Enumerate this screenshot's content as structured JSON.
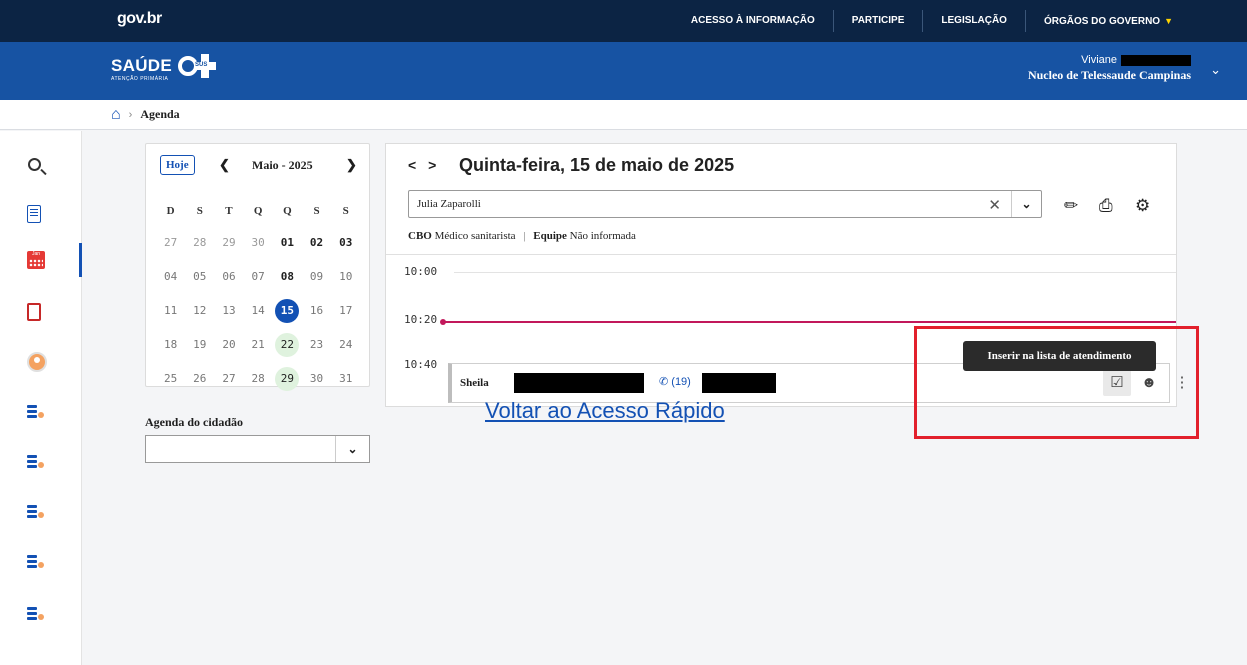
{
  "govbar": {
    "logo": "gov.br",
    "links": [
      "ACESSO À INFORMAÇÃO",
      "PARTICIPE",
      "LEGISLAÇÃO",
      "ÓRGÃOS DO GOVERNO"
    ]
  },
  "header": {
    "brand": "SAÚDE",
    "brand_sub": "ATENÇÃO PRIMÁRIA",
    "esus": "SUS",
    "user_name": "Viviane",
    "unit": "Nucleo de Telessaude Campinas"
  },
  "breadcrumb": {
    "current": "Agenda"
  },
  "sidebar": {
    "items": [
      "search-icon",
      "search-list-icon",
      "calendar-icon",
      "cds-icon",
      "avatar-icon",
      "patient-list-icon",
      "checklist-icon",
      "medical-list-icon",
      "queue-icon",
      "video-list-icon"
    ]
  },
  "mini_calendar": {
    "today_button": "Hoje",
    "month": "Maio - 2025",
    "weekdays": [
      "D",
      "S",
      "T",
      "Q",
      "Q",
      "S",
      "S"
    ],
    "weeks": [
      [
        "27",
        "28",
        "29",
        "30",
        "01",
        "02",
        "03"
      ],
      [
        "04",
        "05",
        "06",
        "07",
        "08",
        "09",
        "10"
      ],
      [
        "11",
        "12",
        "13",
        "14",
        "15",
        "16",
        "17"
      ],
      [
        "18",
        "19",
        "20",
        "21",
        "22",
        "23",
        "24"
      ],
      [
        "25",
        "26",
        "27",
        "28",
        "29",
        "30",
        "31"
      ]
    ],
    "selected": "15",
    "highlighted": [
      "22",
      "29"
    ]
  },
  "agenda_cidadao": {
    "label": "Agenda do cidadão",
    "value": ""
  },
  "main": {
    "date_title": "Quinta-feira, 15 de maio de 2025",
    "professional": "Julia Zaparolli",
    "cbo_label": "CBO",
    "cbo_value": "Médico sanitarista",
    "equipe_label": "Equipe",
    "equipe_value": "Não informada",
    "times": [
      "10:00",
      "10:20",
      "10:40"
    ],
    "appointment": {
      "patient": "Sheila",
      "phone": "(19)"
    },
    "tooltip": "Inserir na lista de atendimento",
    "back_link": "Voltar ao Acesso Rápido"
  },
  "colors": {
    "accent": "#1351b4",
    "header": "#1753a3",
    "govbar": "#0c2444",
    "now_line": "#c2185b",
    "highlight": "#e2202c"
  }
}
